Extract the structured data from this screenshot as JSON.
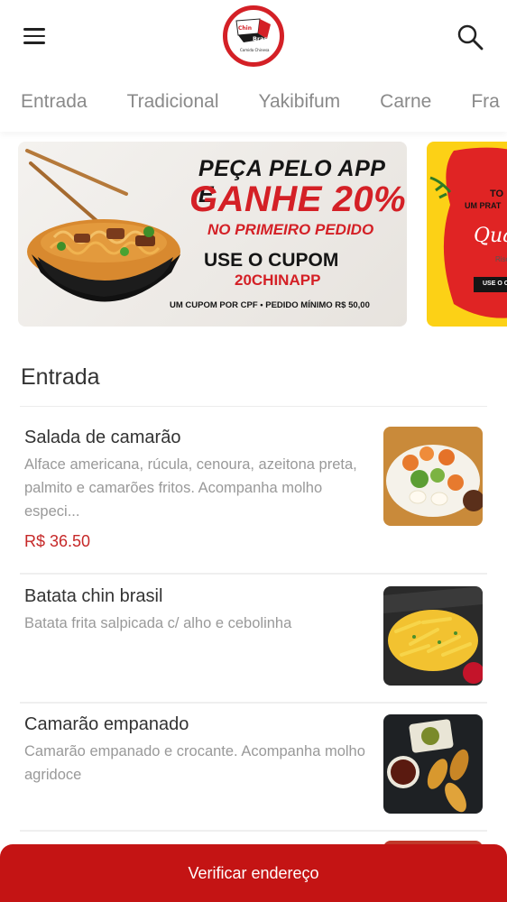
{
  "header": {
    "logo_text_top": "Chin",
    "logo_text_mid": "Brasil",
    "logo_text_bottom": "Comida Chinesa"
  },
  "tabs": [
    {
      "label": "Entrada"
    },
    {
      "label": "Tradicional"
    },
    {
      "label": "Yakibifum"
    },
    {
      "label": "Carne"
    },
    {
      "label": "Fra"
    }
  ],
  "banners": {
    "main": {
      "line1": "PEÇA PELO APP E",
      "line2": "GANHE 20%",
      "line3": "NO PRIMEIRO PEDIDO",
      "line4": "USE O CUPOM",
      "line5": "20CHINAPP",
      "line6": "UM CUPOM POR CPF • PEDIDO MÍNIMO R$ 50,00"
    },
    "second": {
      "title": "TO",
      "sub": "UM PRAT",
      "script": "Qua",
      "small": "Risc",
      "button": "USE O C"
    }
  },
  "section": {
    "title": "Entrada"
  },
  "items": [
    {
      "name": "Salada de camarão",
      "description": "Alface americana, rúcula, cenoura, azeitona preta, palmito e camarões fritos. Acompanha molho especi...",
      "price": "R$ 36.50"
    },
    {
      "name": "Batata chin brasil",
      "description": "Batata frita salpicada c/ alho e cebolinha",
      "price": ""
    },
    {
      "name": "Camarão empanado",
      "description": "Camarão empanado e crocante. Acompanha molho agridoce",
      "price": ""
    }
  ],
  "cta": {
    "label": "Verificar endereço"
  },
  "colors": {
    "brand_red": "#c41414",
    "price_red": "#c62828",
    "promo_red": "#d42026",
    "banner_yellow": "#fcd116"
  }
}
